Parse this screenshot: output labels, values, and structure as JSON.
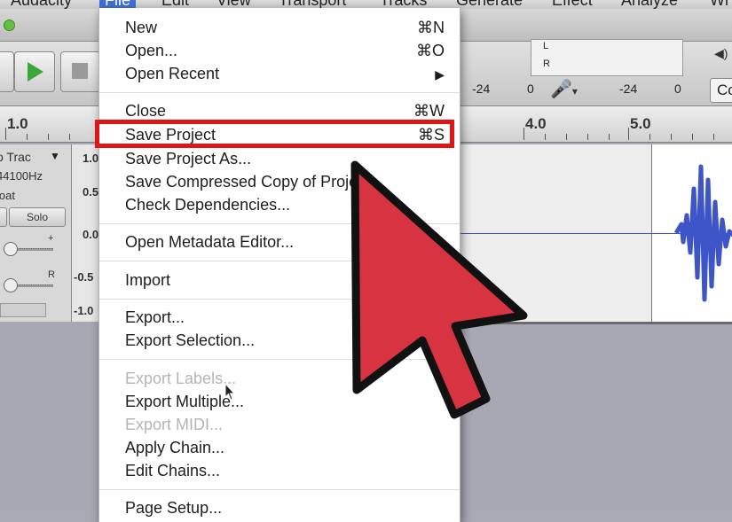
{
  "menubar": {
    "items": [
      "Audacity",
      "File",
      "Edit",
      "View",
      "Transport",
      "Tracks",
      "Generate",
      "Effect",
      "Analyze",
      "Wi"
    ]
  },
  "meter": {
    "channel_l": "L",
    "channel_r": "R",
    "ticks": [
      "-24",
      "0",
      "-24",
      "0"
    ],
    "right_label": "Co"
  },
  "ruler": {
    "labels": [
      "1.0",
      "4.0",
      "5.0"
    ]
  },
  "track_control": {
    "name": "o Trac",
    "rate": "44100Hz",
    "format": "loat",
    "solo_label": "Solo",
    "gain_plus": "+",
    "pan_r": "R"
  },
  "vertical_scale": [
    "1.0",
    "0.5",
    "0.0",
    "-0.5",
    "-1.0"
  ],
  "file_menu": {
    "items": [
      {
        "label": "New",
        "shortcut": "⌘N",
        "enabled": true
      },
      {
        "label": "Open...",
        "shortcut": "⌘O",
        "enabled": true
      },
      {
        "label": "Open Recent",
        "shortcut": "▶",
        "enabled": true
      },
      {
        "label": "Close",
        "shortcut": "⌘W",
        "enabled": true
      },
      {
        "label": "Save Project",
        "shortcut": "⌘S",
        "enabled": true,
        "highlighted": true
      },
      {
        "label": "Save Project As...",
        "shortcut": "",
        "enabled": true
      },
      {
        "label": "Save Compressed Copy of Project...",
        "shortcut": "",
        "enabled": true
      },
      {
        "label": "Check Dependencies...",
        "shortcut": "",
        "enabled": true
      },
      {
        "label": "Open Metadata Editor...",
        "shortcut": "",
        "enabled": true
      },
      {
        "label": "Import",
        "shortcut": "",
        "enabled": true
      },
      {
        "label": "Export...",
        "shortcut": "",
        "enabled": true
      },
      {
        "label": "Export Selection...",
        "shortcut": "",
        "enabled": true
      },
      {
        "label": "Export Labels...",
        "shortcut": "",
        "enabled": false
      },
      {
        "label": "Export Multiple...",
        "shortcut": "",
        "enabled": true
      },
      {
        "label": "Export MIDI...",
        "shortcut": "",
        "enabled": false
      },
      {
        "label": "Apply Chain...",
        "shortcut": "",
        "enabled": true
      },
      {
        "label": "Edit Chains...",
        "shortcut": "",
        "enabled": true
      },
      {
        "label": "Page Setup...",
        "shortcut": "",
        "enabled": true
      }
    ]
  },
  "colors": {
    "highlight_border": "#e01515",
    "big_arrow_fill": "#d83340",
    "waveform": "#3d55c6"
  },
  "icons": {
    "play": "play-icon",
    "stop": "stop-icon",
    "mic": "microphone-icon",
    "pointer": "mouse-pointer-icon",
    "annotation_arrow": "annotation-arrow-icon"
  }
}
